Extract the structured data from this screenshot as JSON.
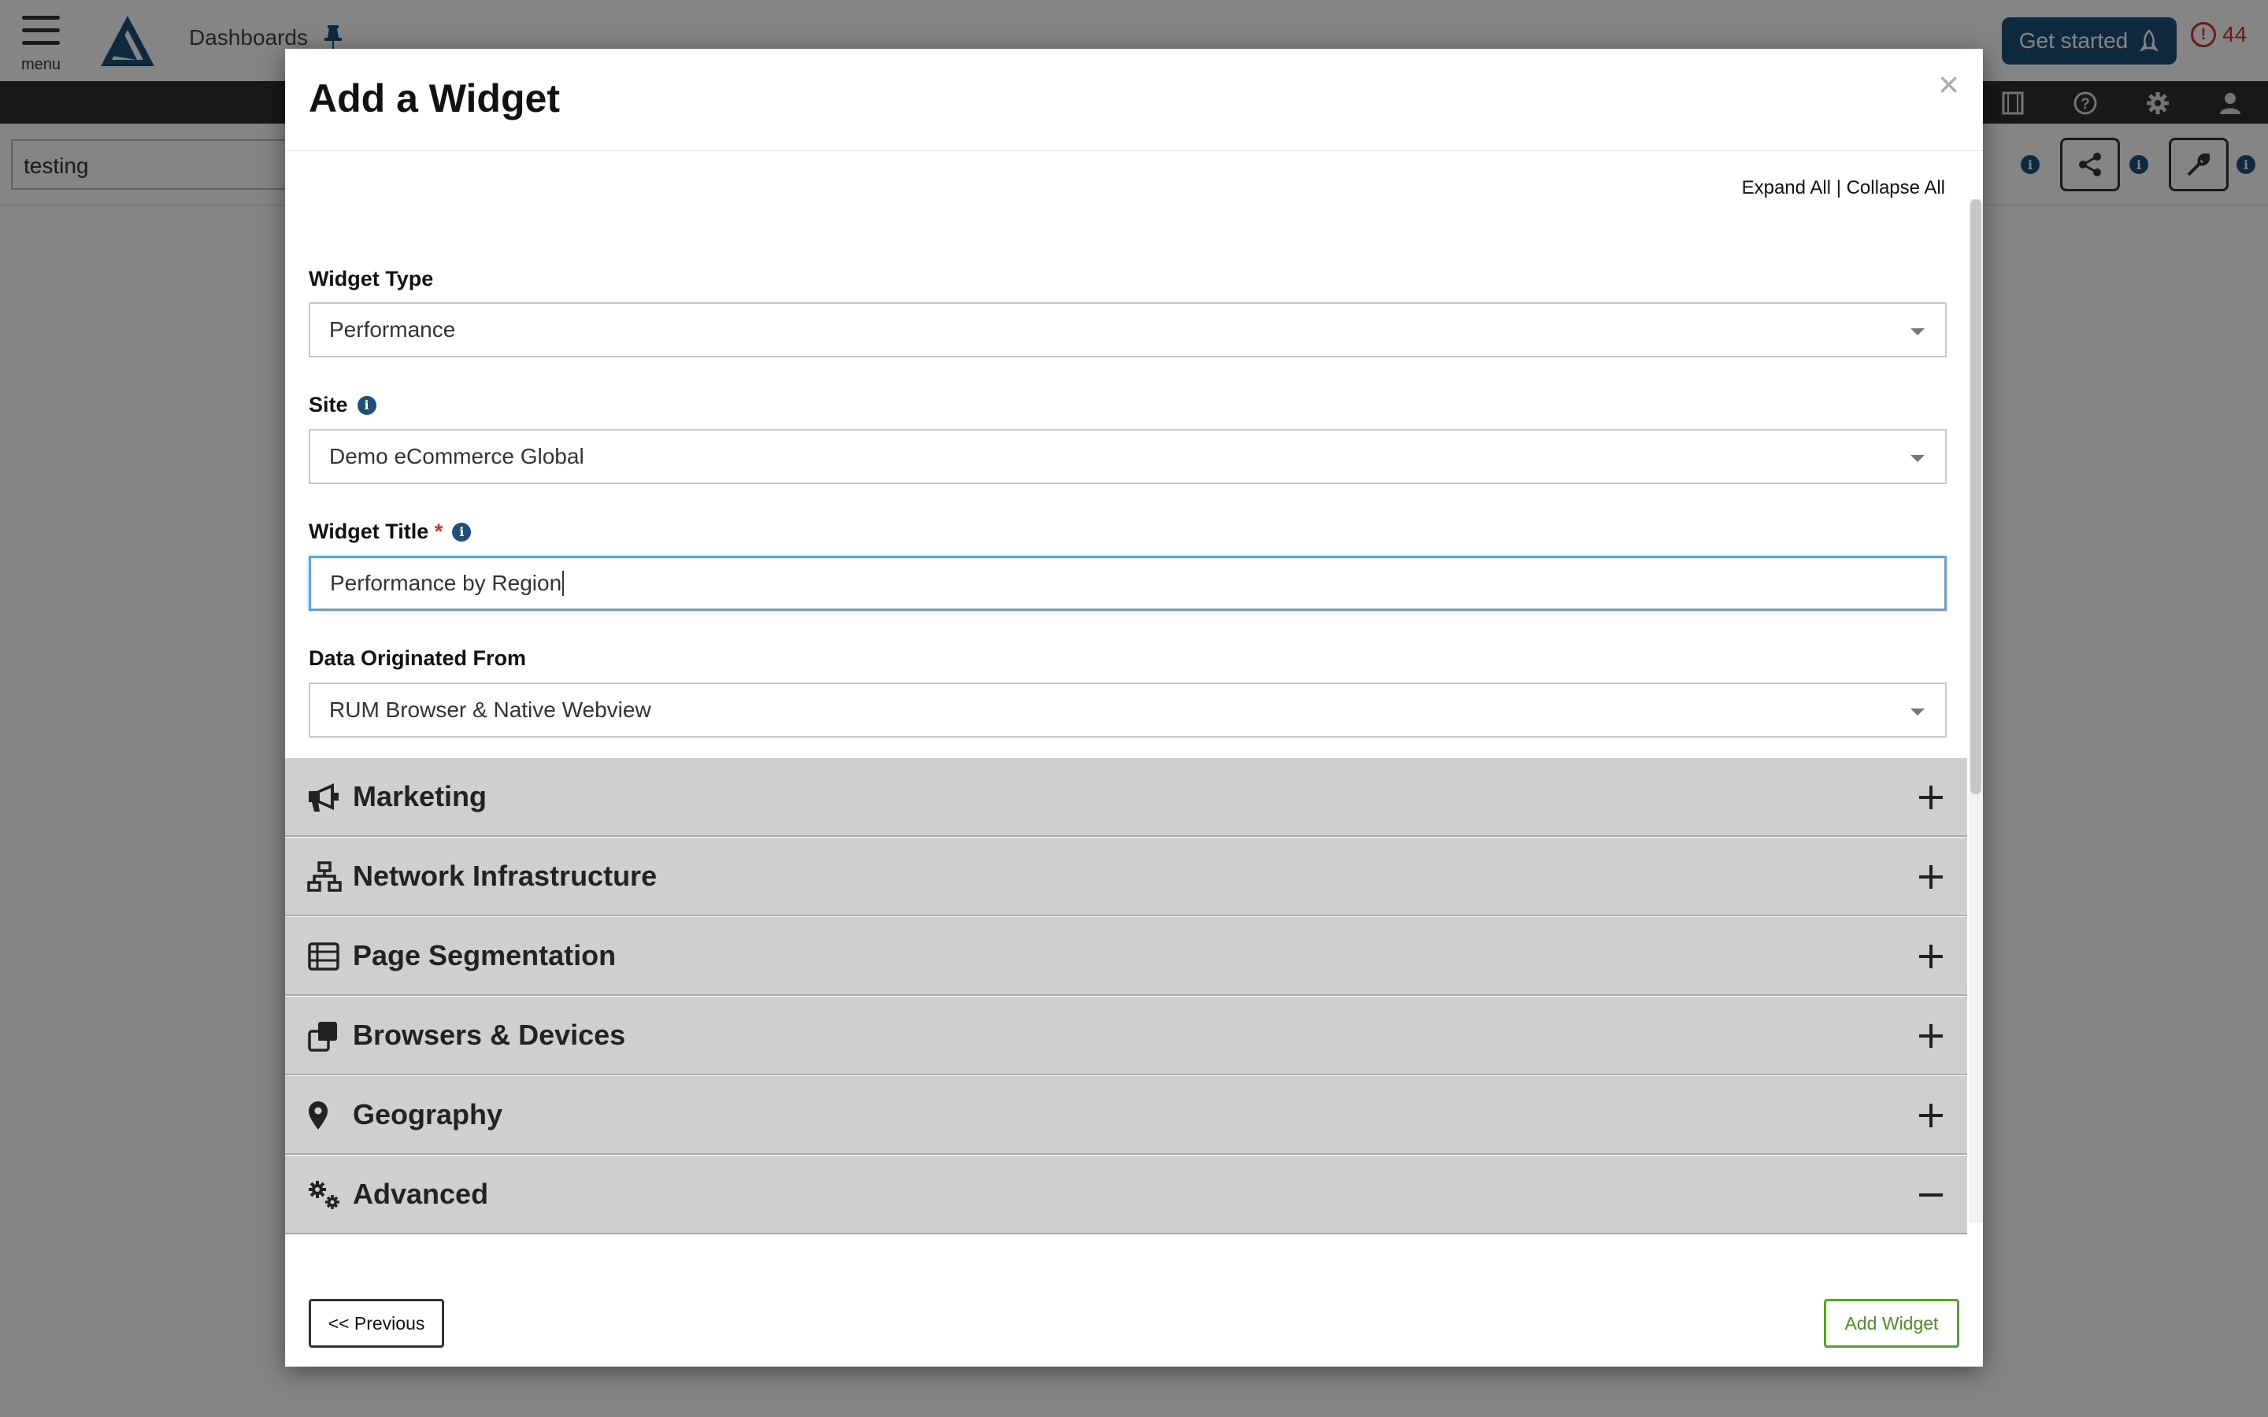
{
  "app": {
    "menu_label": "menu",
    "breadcrumb": "Dashboards",
    "get_started_label": "Get started",
    "alert_count": "44",
    "dashboard_name": "testing",
    "colors": {
      "brand": "#1e4f7a",
      "alert": "#d32f2f",
      "accent_green": "#5aa02c"
    }
  },
  "modal": {
    "title": "Add a Widget",
    "close_label": "×",
    "expand_all": "Expand All",
    "separator": "|",
    "collapse_all": "Collapse All",
    "fields": {
      "widget_type": {
        "label": "Widget Type",
        "value": "Performance"
      },
      "site": {
        "label": "Site",
        "value": "Demo eCommerce Global"
      },
      "widget_title": {
        "label": "Widget Title",
        "required_mark": "*",
        "value": "Performance by Region"
      },
      "data_origin": {
        "label": "Data Originated From",
        "value": "RUM Browser & Native Webview"
      }
    },
    "sections": [
      {
        "label": "Marketing",
        "icon": "megaphone-icon",
        "state": "collapsed"
      },
      {
        "label": "Network Infrastructure",
        "icon": "network-icon",
        "state": "collapsed"
      },
      {
        "label": "Page Segmentation",
        "icon": "table-list-icon",
        "state": "collapsed"
      },
      {
        "label": "Browsers & Devices",
        "icon": "clone-icon",
        "state": "collapsed"
      },
      {
        "label": "Geography",
        "icon": "map-pin-icon",
        "state": "collapsed"
      },
      {
        "label": "Advanced",
        "icon": "gears-icon",
        "state": "expanded"
      }
    ],
    "previous_label": "<< Previous",
    "add_label": "Add Widget"
  }
}
